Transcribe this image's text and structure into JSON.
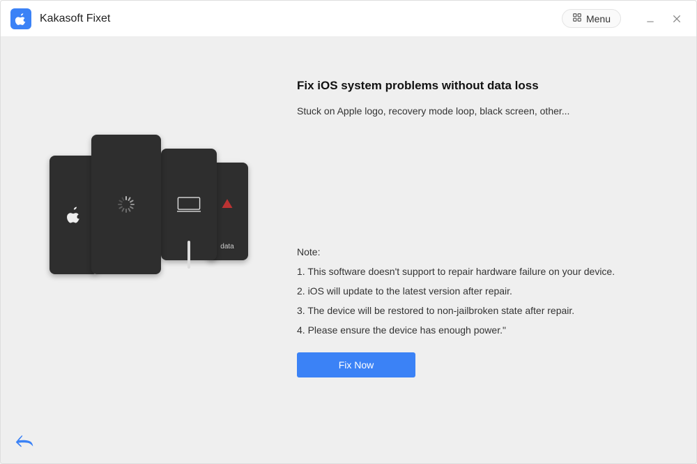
{
  "titlebar": {
    "app_name": "Kakasoft Fixet",
    "menu_label": "Menu"
  },
  "main": {
    "headline": "Fix iOS system problems without data loss",
    "subline": "Stuck on Apple logo, recovery mode loop, black screen, other...",
    "note_title": "Note:",
    "notes": [
      "1. This software doesn't support to repair hardware failure on your device.",
      "2. iOS will update to the latest version after repair.",
      "3. The device will be restored to non-jailbroken state after repair.",
      "4. Please ensure the device has enough power.\""
    ],
    "fix_button": "Fix Now"
  },
  "fan_cards": {
    "data_label": "data"
  }
}
